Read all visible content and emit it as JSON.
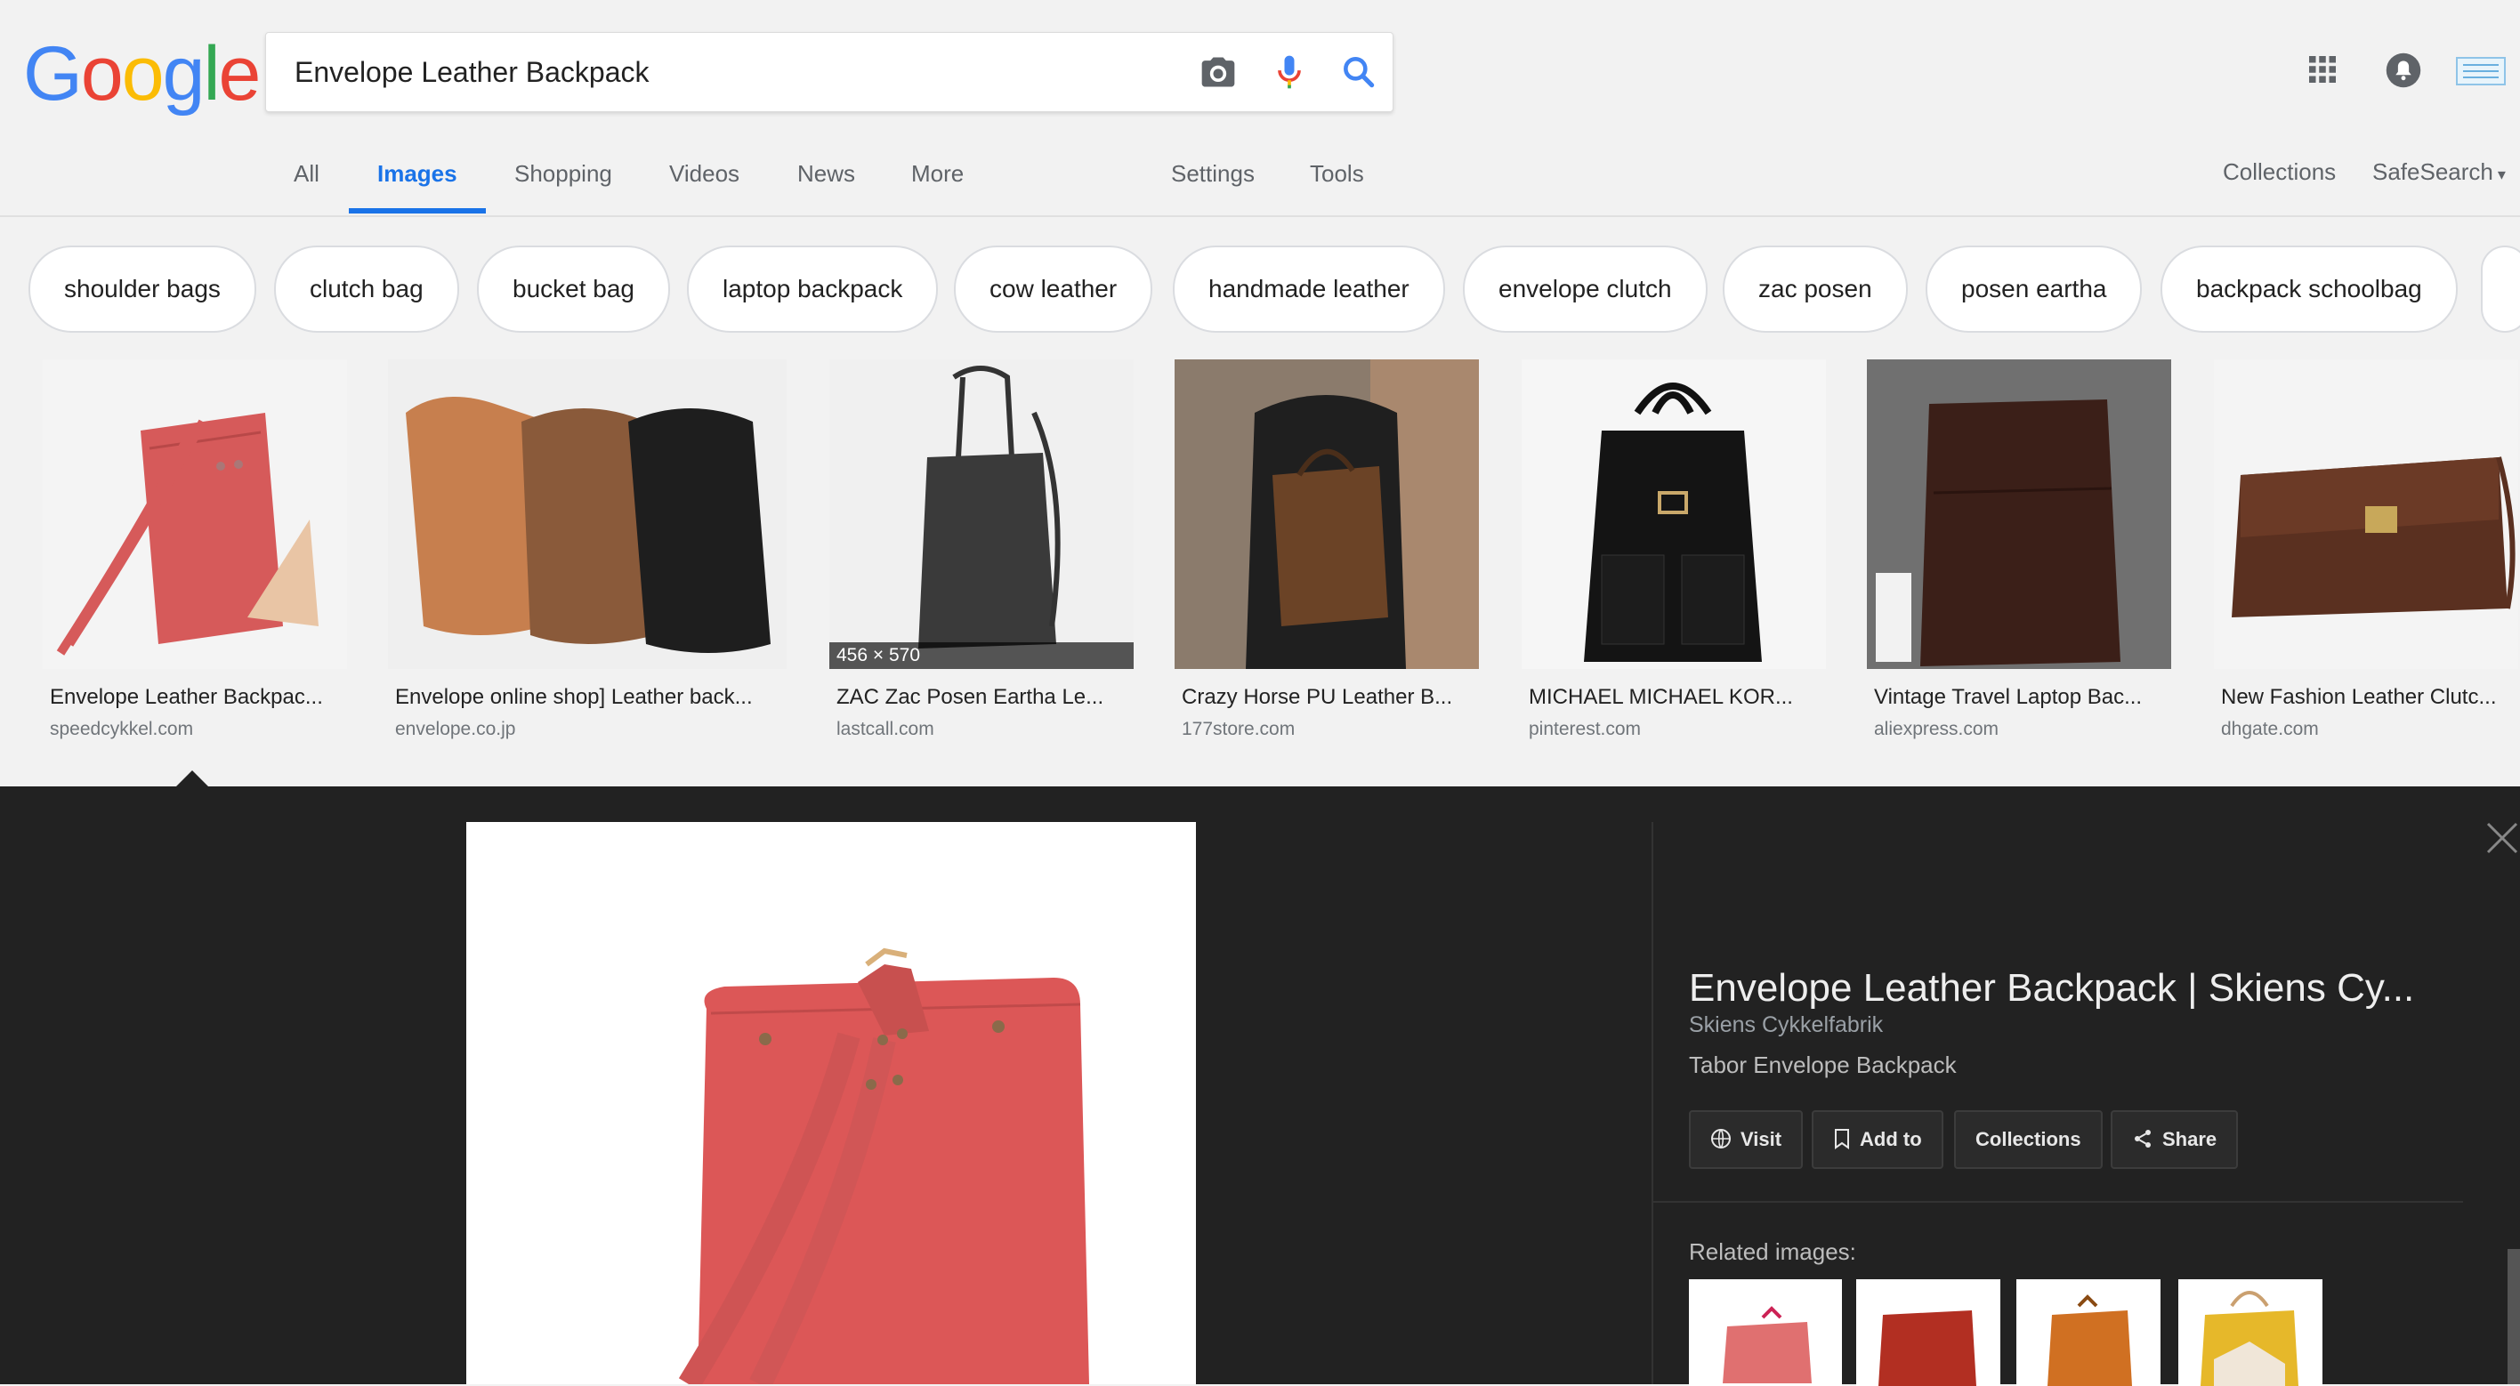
{
  "colors": {
    "google_blue": "#4285F4",
    "google_red": "#EA4335",
    "google_yellow": "#FBBC05",
    "google_green": "#34A853",
    "active_tab": "#1a73e8",
    "preview_bg": "#222222"
  },
  "logo": {
    "letters": [
      "G",
      "o",
      "o",
      "g",
      "l",
      "e"
    ]
  },
  "search": {
    "query": "Envelope Leather Backpack",
    "icons": [
      "camera-icon",
      "microphone-icon",
      "search-icon"
    ]
  },
  "header_right": {
    "icons": [
      "apps-grid-icon",
      "notifications-bell-icon",
      "account-avatar"
    ]
  },
  "nav": {
    "tabs": [
      "All",
      "Images",
      "Shopping",
      "Videos",
      "News",
      "More"
    ],
    "active": "Images",
    "settings": "Settings",
    "tools": "Tools",
    "collections": "Collections",
    "safesearch": "SafeSearch"
  },
  "chips": [
    "shoulder bags",
    "clutch bag",
    "bucket bag",
    "laptop backpack",
    "cow leather",
    "handmade leather",
    "envelope clutch",
    "zac posen",
    "posen eartha",
    "backpack schoolbag"
  ],
  "results": [
    {
      "title": "Envelope Leather Backpac...",
      "source": "speedcykkel.com"
    },
    {
      "title": "Envelope online shop] Leather back...",
      "source": "envelope.co.jp"
    },
    {
      "title": "ZAC Zac Posen Eartha Le...",
      "source": "lastcall.com",
      "dimensions": "456 × 570"
    },
    {
      "title": "Crazy Horse PU Leather B...",
      "source": "177store.com"
    },
    {
      "title": "MICHAEL MICHAEL KOR...",
      "source": "pinterest.com"
    },
    {
      "title": "Vintage Travel Laptop Bac...",
      "source": "aliexpress.com"
    },
    {
      "title": "New Fashion Leather Clutc...",
      "source": "dhgate.com"
    }
  ],
  "preview": {
    "title": "Envelope Leather Backpack | Skiens Cy...",
    "site": "Skiens Cykkelfabrik",
    "description": "Tabor Envelope Backpack",
    "buttons": {
      "visit": "Visit",
      "add_to": "Add to",
      "collections": "Collections",
      "share": "Share"
    },
    "related_label": "Related images:"
  }
}
